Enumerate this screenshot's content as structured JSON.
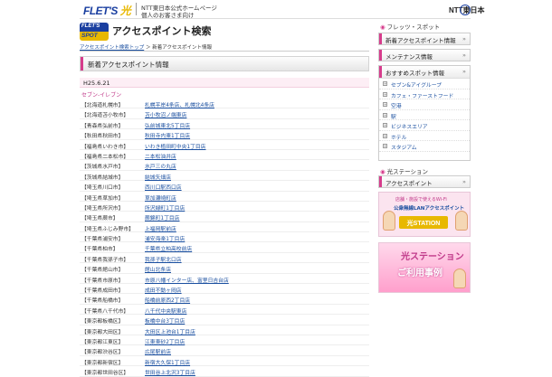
{
  "header": {
    "logo_text": "FLET'S",
    "logo_hikari": "光",
    "corp_line1": "NTT東日本公式ホームページ",
    "corp_line2": "個人のお客さま向け",
    "ntt_label": "NTT東日本"
  },
  "title_area": {
    "spot_top": "FLET'S",
    "spot_bottom": "SPOT",
    "page_title": "アクセスポイント検索"
  },
  "breadcrumb": {
    "link": "アクセスポイント検索トップ",
    "separator": " ＞ ",
    "current": "新着アクセスポイント情報"
  },
  "section": {
    "heading": "新着アクセスポイント情報",
    "date": "H25.6.21",
    "category": "セブン-イレブン"
  },
  "rows": [
    {
      "pref": "【北海道札幌市】",
      "shop": "札幌平岸4条店、札幌北4条店"
    },
    {
      "pref": "【北海道苫小牧市】",
      "shop": "苫小牧沼ノ端東店"
    },
    {
      "pref": "【青森県弘前市】",
      "shop": "弘前城東北5丁目店"
    },
    {
      "pref": "【秋田県秋田市】",
      "shop": "秋田寺内東1丁目店"
    },
    {
      "pref": "【福島県いわき市】",
      "shop": "いわき植田町中央1丁目店"
    },
    {
      "pref": "【福島県二本松市】",
      "shop": "二本松油井店"
    },
    {
      "pref": "【茨城県水戸市】",
      "shop": "水戸三の丸店"
    },
    {
      "pref": "【茨城県結城市】",
      "shop": "結城矢畑店"
    },
    {
      "pref": "【埼玉県川口市】",
      "shop": "西川口駅西口店"
    },
    {
      "pref": "【埼玉県草加市】",
      "shop": "草加瀬崎町店"
    },
    {
      "pref": "【埼玉県所沢市】",
      "shop": "所沢緑町1丁目店"
    },
    {
      "pref": "【埼玉県蕨市】",
      "shop": "蕨錦町1丁目店"
    },
    {
      "pref": "【埼玉県ふじみ野市】",
      "shop": "上福岡駅前店"
    },
    {
      "pref": "【千葉県浦安市】",
      "shop": "浦安海楽1丁目店"
    },
    {
      "pref": "【千葉県柏市】",
      "shop": "千葉県立柏高校前店"
    },
    {
      "pref": "【千葉県我孫子市】",
      "shop": "我孫子駅北口店"
    },
    {
      "pref": "【千葉県館山市】",
      "shop": "館山北条店"
    },
    {
      "pref": "【千葉県市原市】",
      "shop": "市原八幡インター店、富里日吉台店"
    },
    {
      "pref": "【千葉県成田市】",
      "shop": "成田不動ヶ岡店"
    },
    {
      "pref": "【千葉県船橋市】",
      "shop": "船橋前原西2丁目店"
    },
    {
      "pref": "【千葉県八千代市】",
      "shop": "八千代中央駅東店"
    },
    {
      "pref": "【東京都板橋区】",
      "shop": "板橋中台3丁目店"
    },
    {
      "pref": "【東京都大田区】",
      "shop": "大田区上池台1丁目店"
    },
    {
      "pref": "【東京都江東区】",
      "shop": "江東東砂2丁目店"
    },
    {
      "pref": "【東京都渋谷区】",
      "shop": "広尾駅前店"
    },
    {
      "pref": "【東京都新宿区】",
      "shop": "新宿大久保1丁目店"
    },
    {
      "pref": "【東京都世田谷区】",
      "shop": "世田谷上北沢3丁目店"
    }
  ],
  "sidebar": {
    "flets_spot_label": "フレッツ・スポット",
    "btn_new": "新着アクセスポイント情報",
    "btn_maint": "メンテナンス情報",
    "rec_heading": "おすすめスポット情報",
    "rec_items": [
      "セブン&アイグループ",
      "カフェ・ファーストフード",
      "空港",
      "駅",
      "ビジネスエリア",
      "ホテル",
      "スタジアム"
    ],
    "hikari_station_label": "光ステーション",
    "btn_ap": "アクセスポイント",
    "chev": "»",
    "banner1_line1": "店舗・施設で使えるWi-Fi",
    "banner1_line2": "公衆無線LANアクセスポイント",
    "banner1_line3": "光STATION",
    "banner2_line1": "光ステーション",
    "banner2_line2": "ご利用事例"
  },
  "colors": {
    "accent_pink": "#d63c8c",
    "link_blue": "#1a4fa0",
    "brand_blue": "#1a3fa0",
    "brand_yellow": "#e8b800"
  }
}
